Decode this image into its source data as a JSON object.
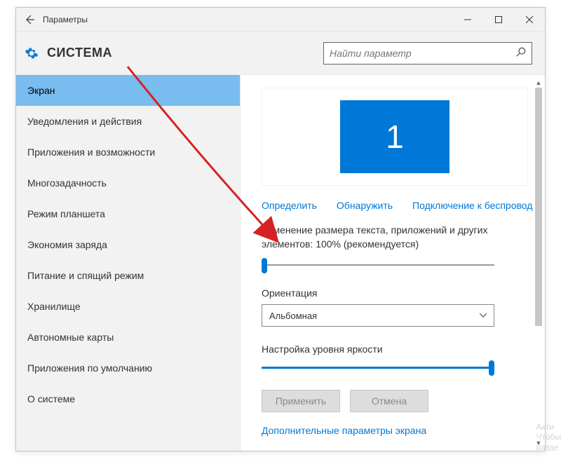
{
  "titlebar": {
    "title": "Параметры"
  },
  "header": {
    "title": "СИСТЕМА",
    "search_placeholder": "Найти параметр"
  },
  "sidebar": {
    "items": [
      "Экран",
      "Уведомления и действия",
      "Приложения и возможности",
      "Многозадачность",
      "Режим планшета",
      "Экономия заряда",
      "Питание и спящий режим",
      "Хранилище",
      "Автономные карты",
      "Приложения по умолчанию",
      "О системе"
    ],
    "selected_index": 0
  },
  "content": {
    "monitor_number": "1",
    "links": {
      "identify": "Определить",
      "detect": "Обнаружить",
      "wireless": "Подключение к беспровод"
    },
    "scaling_label": "Изменение размера текста, приложений и других элементов: 100% (рекомендуется)",
    "orientation_label": "Ориентация",
    "orientation_value": "Альбомная",
    "brightness_label": "Настройка уровня яркости",
    "apply_btn": "Применить",
    "cancel_btn": "Отмена",
    "advanced_link": "Дополнительные параметры экрана"
  },
  "watermark": {
    "line1": "Акти",
    "line2": "Чтобы",
    "line3": "разде"
  }
}
